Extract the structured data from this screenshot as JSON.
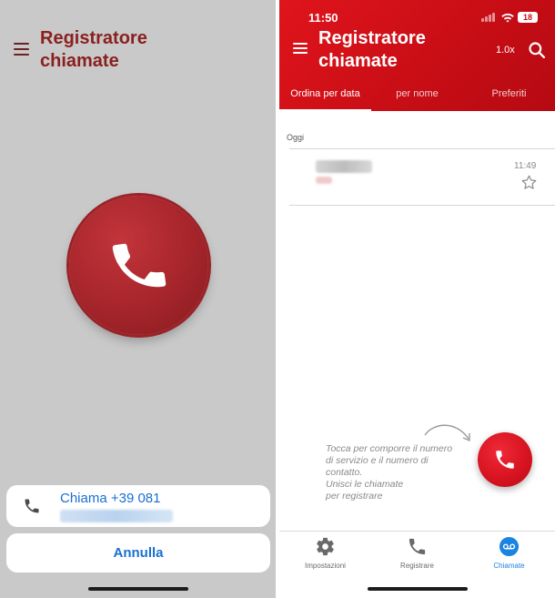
{
  "left_screen": {
    "title": "Registratore chiamate",
    "action_sheet": {
      "call_label": "Chiama +39 081"
    },
    "cancel_label": "Annulla"
  },
  "right_screen": {
    "status_bar": {
      "time": "11:50",
      "battery": "18"
    },
    "header": {
      "title": "Registratore chiamate",
      "speed": "1.0x"
    },
    "tabs": [
      {
        "label": "Ordina per data",
        "active": true
      },
      {
        "label": "per nome",
        "active": false
      },
      {
        "label": "Preferiti",
        "active": false
      }
    ],
    "section_label": "Oggi",
    "recordings": [
      {
        "time": "11:49"
      }
    ],
    "hint_lines": [
      "Tocca per comporre il numero",
      "di servizio e il numero di",
      "contatto.",
      "Unisci le chiamate",
      "per registrare"
    ],
    "bottom_nav": [
      {
        "label": "Impostazioni",
        "icon": "gear-icon",
        "active": false
      },
      {
        "label": "Registrare",
        "icon": "phone-icon",
        "active": false
      },
      {
        "label": "Chiamate",
        "icon": "voicemail-icon",
        "active": true
      }
    ]
  },
  "colors": {
    "brand_red": "#c70d15",
    "dark_red_title": "#8b2020",
    "ios_blue": "#1a6fd1",
    "active_nav_blue": "#1a84e0"
  }
}
